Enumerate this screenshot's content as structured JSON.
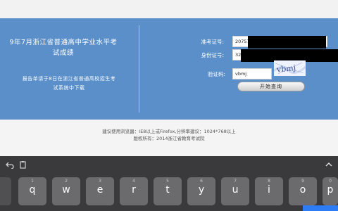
{
  "panel": {
    "title_lines": [
      "9年7月浙江省普通高中学业水平考",
      "试成绩"
    ],
    "notice_lines": [
      "报告单请于8日在浙江省普通高校招生考",
      "试系统中下载"
    ]
  },
  "form": {
    "exam_no_label": "准考证号:",
    "exam_no_value": "20757",
    "id_no_label": "身份证号:",
    "id_no_value": "32",
    "captcha_label": "验证码:",
    "captcha_value": "vbmj",
    "captcha_image_text": "vbmj",
    "query_button": "开始查询"
  },
  "footer": {
    "line1": "建议使用浏览器：IE8以上或Firefox,分辨率建议：1024*768以上",
    "line2": "版权所有：2014浙江省教育考试院"
  },
  "keyboard": {
    "row1": [
      {
        "main": "q",
        "sub": "1"
      },
      {
        "main": "w",
        "sub": "2"
      },
      {
        "main": "e",
        "sub": "3"
      },
      {
        "main": "r",
        "sub": "4"
      },
      {
        "main": "t",
        "sub": "5"
      },
      {
        "main": "y",
        "sub": "6"
      },
      {
        "main": "u",
        "sub": "7"
      },
      {
        "main": "i",
        "sub": "8"
      },
      {
        "main": "o",
        "sub": "9"
      },
      {
        "main": "p",
        "sub": "0"
      }
    ]
  }
}
